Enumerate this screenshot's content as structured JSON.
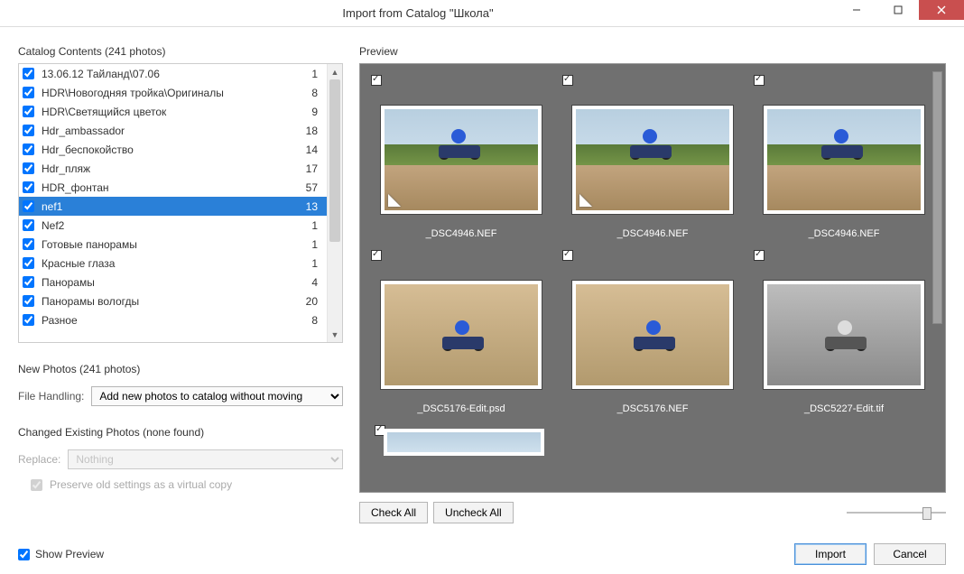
{
  "window": {
    "title": "Import from Catalog \"Школа\""
  },
  "catalog": {
    "heading": "Catalog Contents (241 photos)",
    "items": [
      {
        "name": "13.06.12 Тайланд\\07.06",
        "count": "1",
        "checked": true,
        "selected": false
      },
      {
        "name": "HDR\\Новогодняя тройка\\Оригиналы",
        "count": "8",
        "checked": true,
        "selected": false
      },
      {
        "name": "HDR\\Светящийся цветок",
        "count": "9",
        "checked": true,
        "selected": false
      },
      {
        "name": "Hdr_ambassador",
        "count": "18",
        "checked": true,
        "selected": false
      },
      {
        "name": "Hdr_беспокойство",
        "count": "14",
        "checked": true,
        "selected": false
      },
      {
        "name": "Hdr_пляж",
        "count": "17",
        "checked": true,
        "selected": false
      },
      {
        "name": "HDR_фонтан",
        "count": "57",
        "checked": true,
        "selected": false
      },
      {
        "name": "nef1",
        "count": "13",
        "checked": true,
        "selected": true
      },
      {
        "name": "Nef2",
        "count": "1",
        "checked": true,
        "selected": false
      },
      {
        "name": "Готовые панорамы",
        "count": "1",
        "checked": true,
        "selected": false
      },
      {
        "name": "Красные глаза",
        "count": "1",
        "checked": true,
        "selected": false
      },
      {
        "name": "Панорамы",
        "count": "4",
        "checked": true,
        "selected": false
      },
      {
        "name": "Панорамы вологды",
        "count": "20",
        "checked": true,
        "selected": false
      },
      {
        "name": "Разное",
        "count": "8",
        "checked": true,
        "selected": false
      }
    ]
  },
  "newPhotos": {
    "heading": "New Photos (241 photos)",
    "fileHandlingLabel": "File Handling:",
    "fileHandlingValue": "Add new photos to catalog without moving"
  },
  "changed": {
    "heading": "Changed Existing Photos (none found)",
    "replaceLabel": "Replace:",
    "replaceValue": "Nothing",
    "preserveLabel": "Preserve old settings as a virtual copy"
  },
  "preview": {
    "heading": "Preview",
    "thumbs": [
      {
        "caption": "_DSC4946.NEF",
        "dogear": true,
        "style": "jump"
      },
      {
        "caption": "_DSC4946.NEF",
        "dogear": true,
        "style": "jump"
      },
      {
        "caption": "_DSC4946.NEF",
        "dogear": false,
        "style": "jump"
      },
      {
        "caption": "_DSC5176-Edit.psd",
        "dogear": false,
        "style": "ride"
      },
      {
        "caption": "_DSC5176.NEF",
        "dogear": false,
        "style": "ride"
      },
      {
        "caption": "_DSC5227-Edit.tif",
        "dogear": false,
        "style": "gray"
      }
    ],
    "checkAll": "Check All",
    "uncheckAll": "Uncheck All"
  },
  "footer": {
    "showPreview": "Show Preview",
    "import": "Import",
    "cancel": "Cancel"
  }
}
